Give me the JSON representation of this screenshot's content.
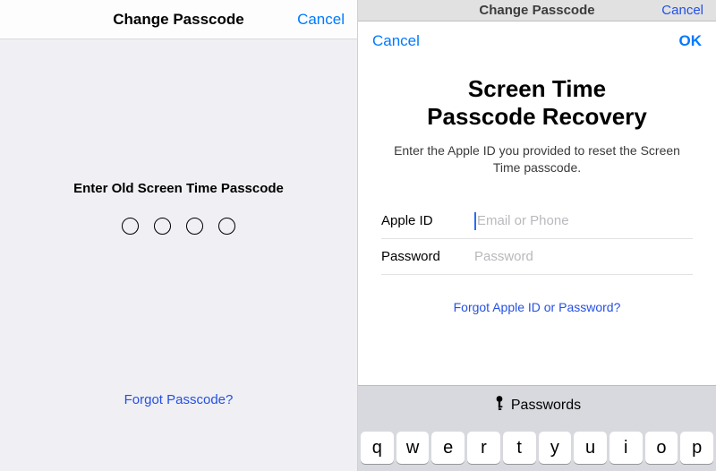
{
  "colors": {
    "accent": "#007aff",
    "link": "#2450e2"
  },
  "left": {
    "title": "Change Passcode",
    "cancel": "Cancel",
    "prompt": "Enter Old Screen Time Passcode",
    "passcode_length": 4,
    "forgot": "Forgot Passcode?"
  },
  "right_bg": {
    "title": "Change Passcode",
    "cancel": "Cancel"
  },
  "sheet": {
    "cancel": "Cancel",
    "ok": "OK",
    "title_line1": "Screen Time",
    "title_line2": "Passcode Recovery",
    "subtitle": "Enter the Apple ID you provided to reset the Screen Time passcode.",
    "fields": {
      "apple_id": {
        "label": "Apple ID",
        "placeholder": "Email or Phone",
        "value": ""
      },
      "password": {
        "label": "Password",
        "placeholder": "Password",
        "value": ""
      }
    },
    "forgot": "Forgot Apple ID or Password?"
  },
  "keyboard": {
    "autofill_label": "Passwords",
    "autofill_icon": "key-icon",
    "row1": [
      "q",
      "w",
      "e",
      "r",
      "t",
      "y",
      "u",
      "i",
      "o",
      "p"
    ]
  }
}
